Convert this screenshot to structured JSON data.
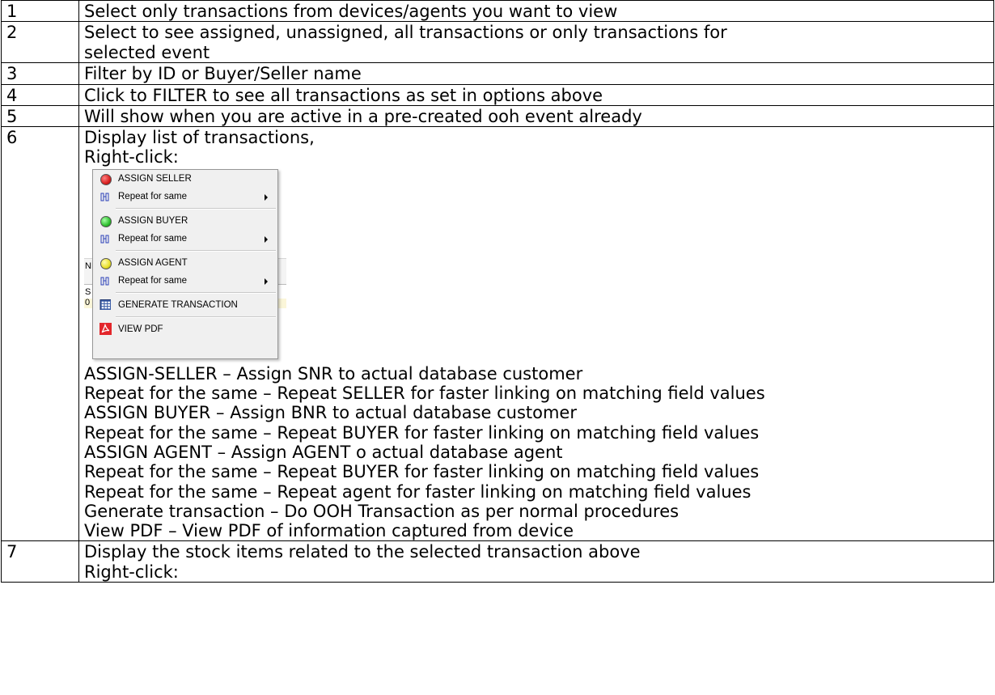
{
  "rows": [
    {
      "num": "1",
      "lines": [
        "Select only transactions from devices/agents you want to view"
      ]
    },
    {
      "num": "2",
      "lines": [
        "Select to see assigned, unassigned, all transactions or only transactions for",
        "selected event"
      ]
    },
    {
      "num": "3",
      "lines": [
        "Filter by ID or Buyer/Seller name"
      ]
    },
    {
      "num": "4",
      "lines": [
        "Click to FILTER to see all transactions as set in options above"
      ]
    },
    {
      "num": "5",
      "lines": [
        "Will show when you are active in a pre-created ooh event already"
      ]
    }
  ],
  "row6": {
    "num": "6",
    "intro": [
      "Display list of transactions,",
      "Right-click:"
    ],
    "menu": {
      "assign_seller": "ASSIGN SELLER",
      "repeat_1": "Repeat for same",
      "assign_buyer": "ASSIGN BUYER",
      "repeat_2": "Repeat for same",
      "assign_agent": "ASSIGN AGENT",
      "repeat_3": "Repeat for same",
      "generate": "GENERATE TRANSACTION",
      "view_pdf": "VIEW PDF",
      "colors": {
        "seller_dot": "#d81f1f",
        "buyer_dot": "#2fbf2f",
        "agent_dot": "#e8e02a",
        "pdf_red": "#e3262b",
        "repeat_blue": "#2a3fb8"
      }
    },
    "background_fragments": {
      "a": "NF",
      "b": "S",
      "c": "0"
    },
    "descriptions": [
      "ASSIGN-SELLER – Assign SNR to actual database customer",
      "Repeat for the same – Repeat SELLER for faster linking on matching field values",
      "ASSIGN BUYER – Assign BNR to actual database customer",
      "Repeat for the same – Repeat BUYER for faster linking on matching field values",
      "ASSIGN AGENT  – Assign AGENT o actual database agent",
      "Repeat for the same – Repeat BUYER for faster linking on matching field values",
      "Repeat for the same – Repeat agent for faster linking on matching field values",
      "Generate transaction – Do OOH Transaction as per normal procedures",
      "View PDF – View PDF of information captured from device"
    ]
  },
  "row7": {
    "num": "7",
    "lines": [
      "Display the stock items related to the selected transaction above",
      "Right-click:"
    ]
  }
}
